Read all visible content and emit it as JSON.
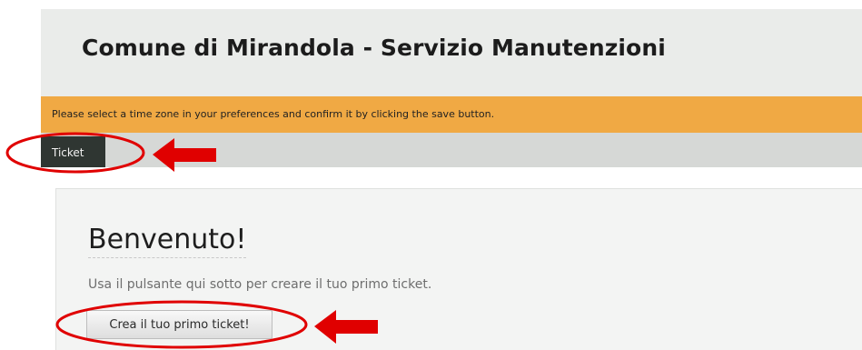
{
  "header": {
    "title": "Comune di Mirandola - Servizio Manutenzioni"
  },
  "notice": {
    "message": "Please select a time zone in your preferences and confirm it by clicking the save button."
  },
  "nav": {
    "tabs": [
      {
        "label": "Ticket"
      }
    ]
  },
  "main": {
    "welcome_title": "Benvenuto!",
    "welcome_text": "Usa il pulsante qui sotto per creare il tuo primo ticket.",
    "create_button_label": "Crea il tuo primo ticket!"
  },
  "colors": {
    "header_background": "#eaecea",
    "notice_background": "#f0a944",
    "nav_background": "#d6d8d6",
    "active_tab_background": "#2f3632",
    "annotation_red": "#e00000"
  },
  "annotations": [
    {
      "type": "ellipse",
      "target": "Ticket"
    },
    {
      "type": "arrow",
      "target": "Ticket",
      "direction": "left"
    },
    {
      "type": "ellipse",
      "target": "Crea il tuo primo ticket!"
    },
    {
      "type": "arrow",
      "target": "Crea il tuo primo ticket!",
      "direction": "left"
    }
  ]
}
